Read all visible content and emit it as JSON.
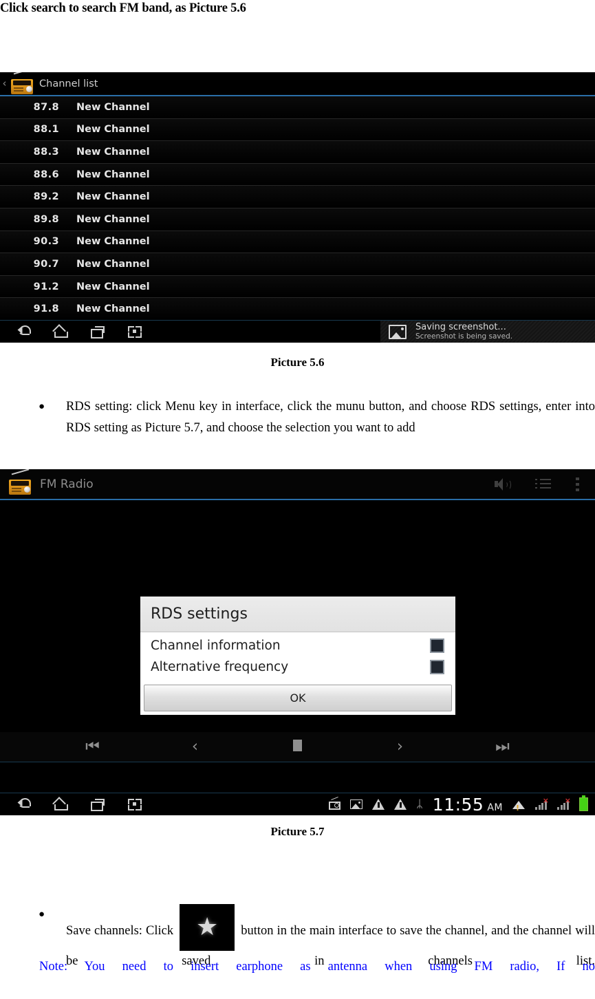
{
  "document": {
    "heading": "Click search to search FM band, as Picture 5.6",
    "caption_56": "Picture 5.6",
    "caption_57": "Picture 5.7",
    "bullet_rds": "RDS setting: click Menu key in interface, click the munu button, and choose RDS settings, enter into RDS setting as Picture 5.7, and choose the selection you want to add",
    "bullet_save_prefix": "Save channels: Click",
    "bullet_save_suffix": "button in the main interface to save the channel, and the channel will be saved in channels list.",
    "note_line": "Note: You need to insert earphone as antenna when using FM radio, If no",
    "bullet_marker": "●",
    "note_color": "#0000ff"
  },
  "picture_56": {
    "appbar": {
      "back_label": "‹",
      "title": "Channel list",
      "icon": "radio-icon",
      "divider_color": "#2a6ea8"
    },
    "channels": [
      {
        "frequency": "87.8",
        "name": "New Channel"
      },
      {
        "frequency": "88.1",
        "name": "New Channel"
      },
      {
        "frequency": "88.3",
        "name": "New Channel"
      },
      {
        "frequency": "88.6",
        "name": "New Channel"
      },
      {
        "frequency": "89.2",
        "name": "New Channel"
      },
      {
        "frequency": "89.8",
        "name": "New Channel"
      },
      {
        "frequency": "90.3",
        "name": "New Channel"
      },
      {
        "frequency": "90.7",
        "name": "New Channel"
      },
      {
        "frequency": "91.2",
        "name": "New Channel"
      },
      {
        "frequency": "91.8",
        "name": "New Channel"
      }
    ],
    "navbar": {
      "back": "back-icon",
      "home": "home-icon",
      "recents": "recents-icon",
      "screenshot": "screenshot-icon"
    },
    "notification": {
      "icon": "image-icon",
      "title": "Saving screenshot...",
      "subtitle": "Screenshot is being saved."
    }
  },
  "picture_57": {
    "appbar": {
      "title": "FM Radio",
      "icon": "radio-icon",
      "actions": [
        {
          "name": "speaker-icon"
        },
        {
          "name": "list-icon"
        },
        {
          "name": "overflow-menu-icon"
        }
      ],
      "divider_color": "#2a6ea8"
    },
    "dialog": {
      "title": "RDS settings",
      "options": [
        {
          "label": "Channel information",
          "checked": false
        },
        {
          "label": "Alternative frequency",
          "checked": false
        }
      ],
      "ok_label": "OK"
    },
    "transport": [
      {
        "name": "skip-previous-icon",
        "glyph": "⏮"
      },
      {
        "name": "previous-icon",
        "glyph": "‹"
      },
      {
        "name": "stop-icon",
        "glyph": ""
      },
      {
        "name": "next-icon",
        "glyph": "›"
      },
      {
        "name": "skip-next-icon",
        "glyph": "⏭"
      }
    ],
    "navbar": {
      "back": "back-icon",
      "home": "home-icon",
      "recents": "recents-icon",
      "screenshot": "screenshot-icon"
    },
    "statusbar": {
      "bluetooth_glyph": "ᛦ",
      "clock_time": "11:55",
      "clock_ampm": "AM",
      "wifi_alert": "!",
      "signal_x": "×",
      "battery_color": "#45d215"
    }
  }
}
